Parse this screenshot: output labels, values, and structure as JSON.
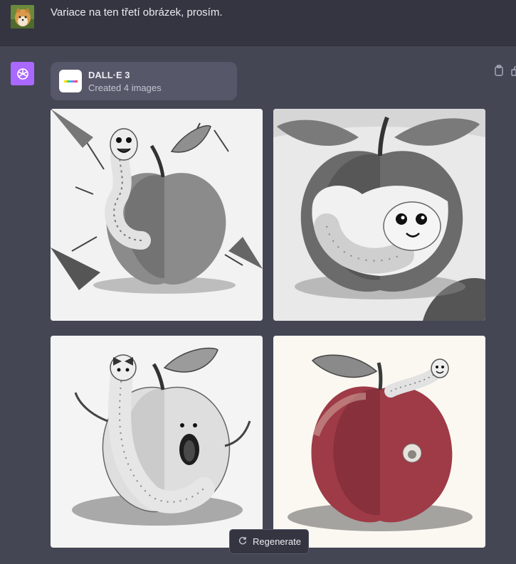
{
  "user_message": {
    "text": "Variace na ten třetí obrázek, prosím."
  },
  "assistant": {
    "tool_card": {
      "title": "DALL·E 3",
      "subtitle": "Created 4 images"
    },
    "images": [
      {
        "icon": "worm-in-apple-drawing"
      },
      {
        "icon": "worm-inside-apple-drawing"
      },
      {
        "icon": "worm-with-bowtie-apple-drawing"
      },
      {
        "icon": "red-apple-with-worm-drawing"
      }
    ]
  },
  "regenerate_button": {
    "label": "Regenerate",
    "icon": "refresh-icon"
  },
  "colors": {
    "background": "#444654",
    "user_row": "#343541",
    "assistant_avatar": "#ab68ff"
  }
}
